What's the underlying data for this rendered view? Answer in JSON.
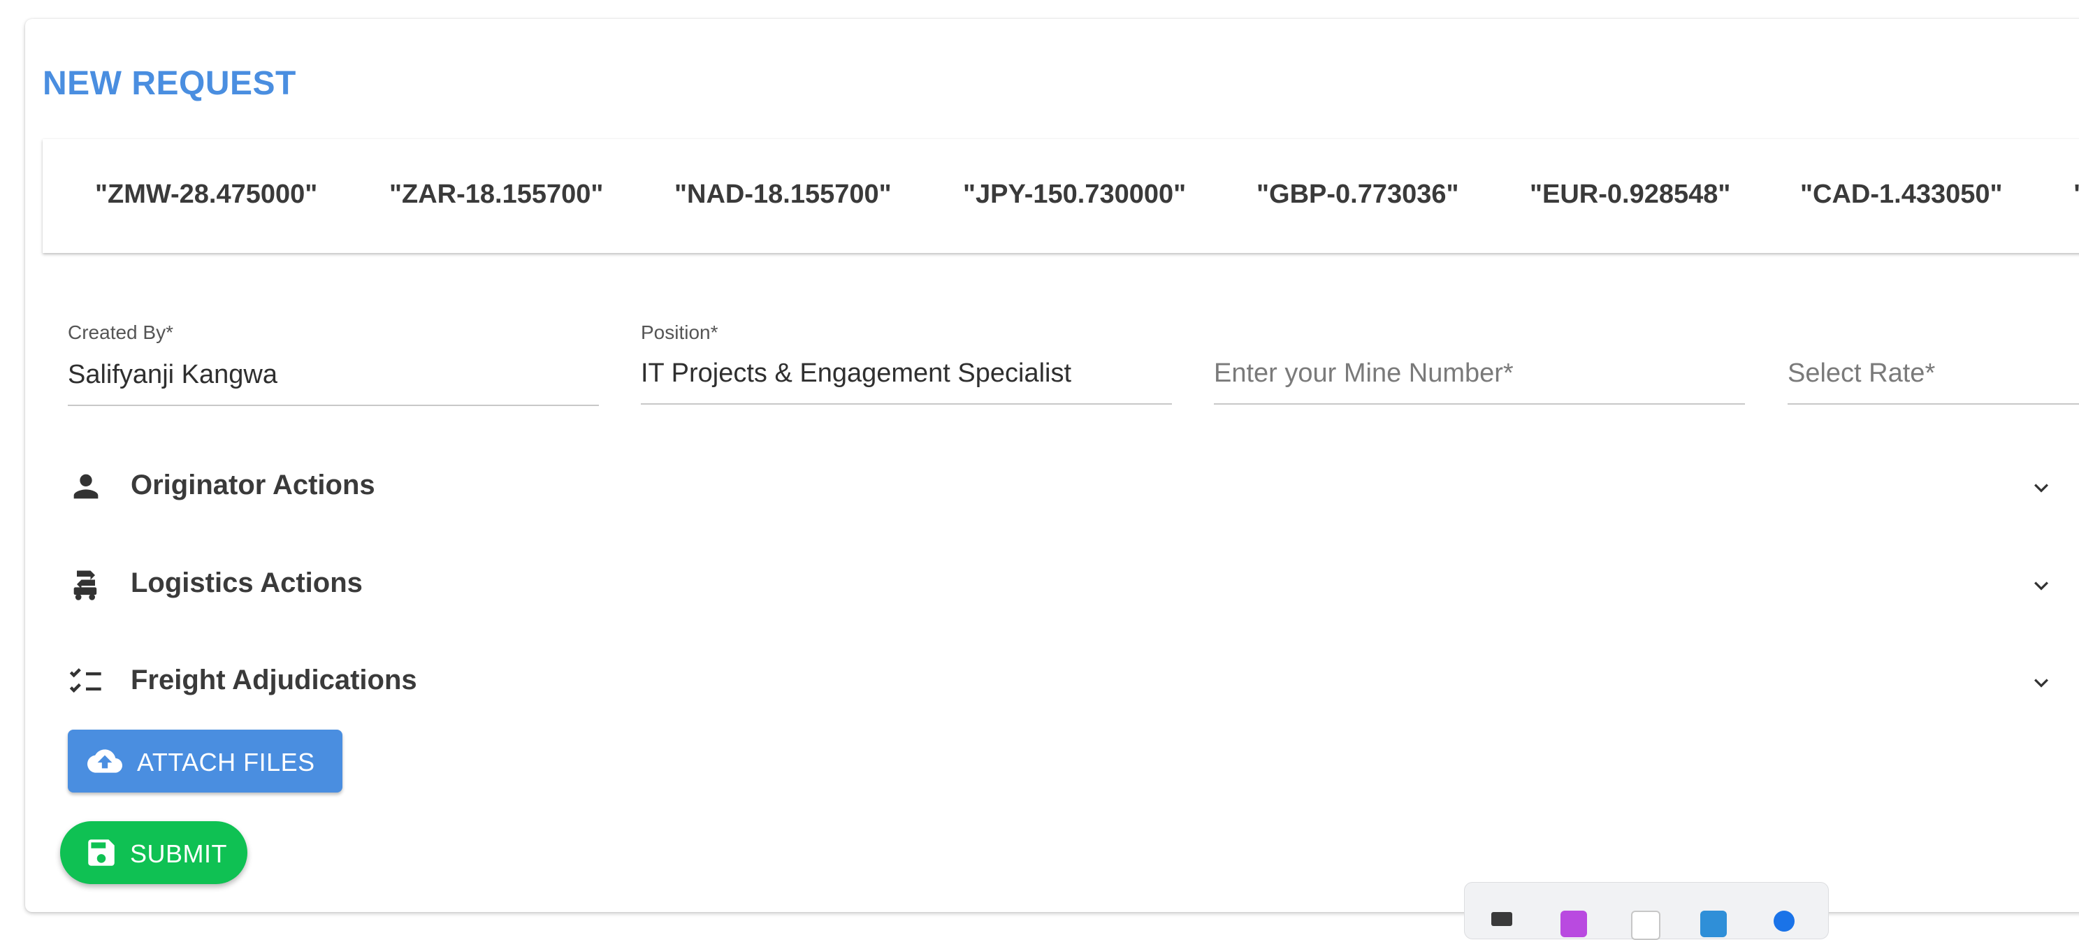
{
  "page": {
    "title": "NEW REQUEST"
  },
  "rates": [
    "\"ZMW-28.475000\"",
    "\"ZAR-18.155700\"",
    "\"NAD-18.155700\"",
    "\"JPY-150.730000\"",
    "\"GBP-0.773036\"",
    "\"EUR-0.928548\"",
    "\"CAD-1.433050\"",
    "\""
  ],
  "form": {
    "created_by": {
      "label": "Created By*",
      "value": "Salifyanji Kangwa"
    },
    "position": {
      "label": "Position*",
      "value": "IT Projects & Engagement Specialist"
    },
    "mine_number": {
      "placeholder": "Enter your Mine Number*"
    },
    "rate": {
      "placeholder": "Select Rate*"
    }
  },
  "sections": [
    {
      "title": "Originator Actions",
      "icon": "person-icon"
    },
    {
      "title": "Logistics Actions",
      "icon": "truck-swap-icon"
    },
    {
      "title": "Freight Adjudications",
      "icon": "checklist-icon"
    }
  ],
  "buttons": {
    "attach": {
      "label": "ATTACH FILES",
      "icon": "cloud-upload-icon"
    },
    "submit": {
      "label": "SUBMIT",
      "icon": "save-icon"
    }
  },
  "colors": {
    "accent": "#4a8ee0",
    "submit": "#0fc153",
    "text": "#3a3a3a"
  }
}
